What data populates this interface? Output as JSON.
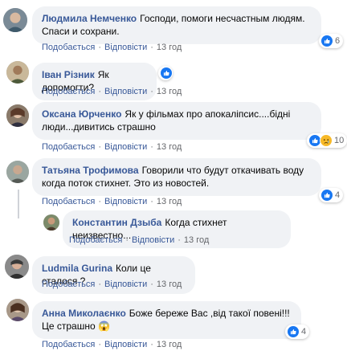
{
  "comments": [
    {
      "author": "Людмила Немченко",
      "text": "Господи, помоги несчастным людям. Спаси и сохрани.",
      "like_action": "Подобається",
      "reply_action": "Відповісти",
      "time": "13 год",
      "reactions": [
        "like-icon"
      ],
      "reaction_count": "6"
    },
    {
      "author": "Іван Різник",
      "text": "Як допомогти?",
      "like_action": "Подобається",
      "reply_action": "Відповісти",
      "time": "13 год",
      "reactions": [
        "like-icon"
      ],
      "reaction_count": ""
    },
    {
      "author": "Оксана Юрченко",
      "text": "Як у фільмах про апокаліпсис....бідні люди...дивитись страшно",
      "like_action": "Подобається",
      "reply_action": "Відповісти",
      "time": "13 год",
      "reactions": [
        "like-icon",
        "sad-icon"
      ],
      "reaction_count": "10"
    },
    {
      "author": "Татьяна Трофимова",
      "text": "Говорили что будут откачивать воду когда поток стихнет. Это из новостей.",
      "like_action": "Подобається",
      "reply_action": "Відповісти",
      "time": "13 год",
      "reactions": [
        "like-icon"
      ],
      "reaction_count": "4"
    },
    {
      "author": "Константин Дзыба",
      "text": "Когда стихнет неизвестно...",
      "like_action": "Подобається",
      "reply_action": "Відповісти",
      "time": "13 год",
      "reactions": [],
      "reaction_count": ""
    },
    {
      "author": "Ludmila Gurina",
      "text": "Коли це сталося ?",
      "like_action": "Подобається",
      "reply_action": "Відповісти",
      "time": "13 год",
      "reactions": [],
      "reaction_count": ""
    },
    {
      "author": "Анна Миколаєнко",
      "text": "Боже береже Вас ,від такої повені!!! Це страшно 😱",
      "like_action": "Подобається",
      "reply_action": "Відповісти",
      "time": "13 год",
      "reactions": [
        "like-icon"
      ],
      "reaction_count": "4"
    }
  ],
  "colors": {
    "author": "#385898",
    "bubble": "#f0f2f5",
    "like": "#1877f2",
    "sad": "#f7b928"
  }
}
